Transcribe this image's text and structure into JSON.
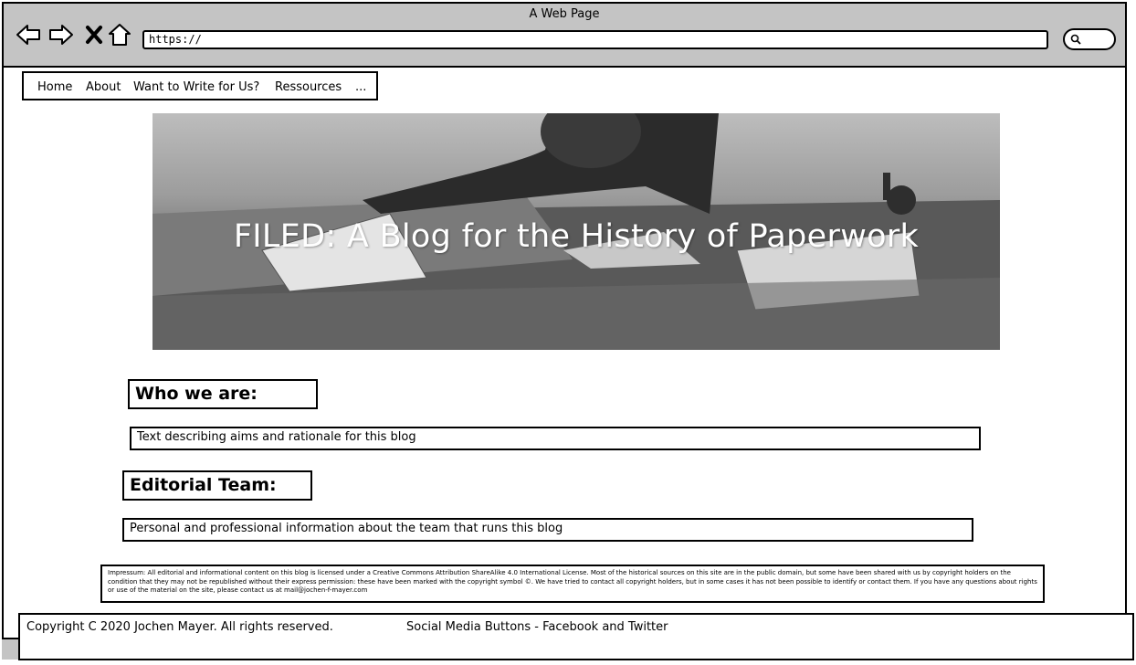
{
  "window": {
    "title": "A Web Page",
    "url": "https://"
  },
  "nav_icons": [
    "back-arrow-icon",
    "forward-arrow-icon",
    "close-x-icon",
    "home-icon"
  ],
  "menu": {
    "items": [
      {
        "label": "Home"
      },
      {
        "label": "About"
      },
      {
        "label": "Want to Write for Us?"
      },
      {
        "label": "Ressources"
      },
      {
        "label": "..."
      }
    ]
  },
  "hero": {
    "title": "FILED: A Blog for the History of Paperwork"
  },
  "sections": {
    "who": {
      "heading": "Who we are:",
      "text": "Text describing aims and rationale for this blog"
    },
    "team": {
      "heading": "Editorial Team:",
      "text": "Personal and professional information about the team that runs this blog"
    }
  },
  "impressum": "Impressum: All editorial and informational content on this blog is licensed under a Creative Commons  Attribution ShareAlike 4.0 International License. Most of the historical sources on this site are in the public domain, but some have been shared with us by copyright holders on the condition that they may not be republished without their express permission: these have been marked with the copyright symbol ©. We have tried to contact all copyright holders, but in some cases it has not been possible to identify or contact them. If you have any questions about rights or use of the material on the site, please contact us at mail@jochen-f-mayer.com",
  "footer": {
    "copyright": "Copyright C 2020 Jochen Mayer. All rights reserved.",
    "social": "Social Media Buttons - Facebook and Twitter"
  },
  "colors": {
    "chrome": "#c4c4c4",
    "border": "#000000",
    "hero_text": "#ffffff"
  }
}
